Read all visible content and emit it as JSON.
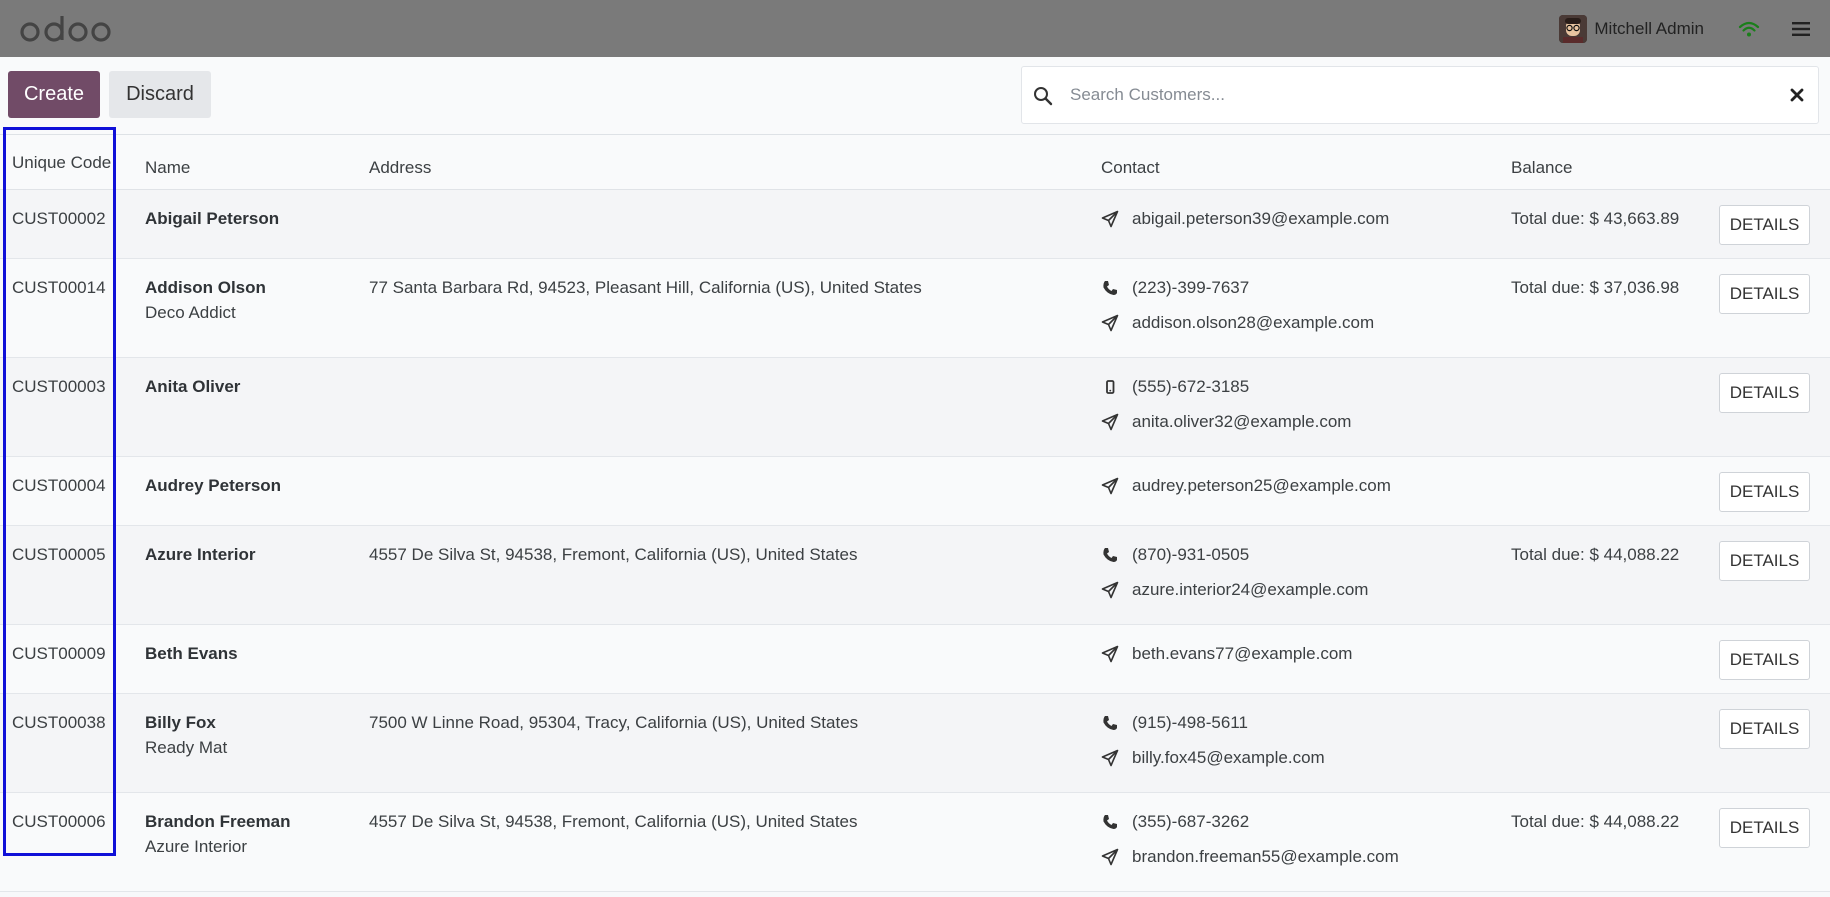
{
  "navbar": {
    "user_name": "Mitchell Admin"
  },
  "controls": {
    "create_label": "Create",
    "discard_label": "Discard",
    "search_placeholder": "Search Customers..."
  },
  "table": {
    "headers": {
      "code": "Unique Code",
      "name": "Name",
      "address": "Address",
      "contact": "Contact",
      "balance": "Balance"
    },
    "details_label": "DETAILS",
    "rows": [
      {
        "code": "CUST00002",
        "name": "Abigail Peterson",
        "company": "",
        "address": "",
        "phone": "",
        "phone_type": "",
        "email": "abigail.peterson39@example.com",
        "balance": "Total due: $ 43,663.89"
      },
      {
        "code": "CUST00014",
        "name": "Addison Olson",
        "company": "Deco Addict",
        "address": "77 Santa Barbara Rd, 94523, Pleasant Hill, California (US), United States",
        "phone": "(223)-399-7637",
        "phone_type": "phone",
        "email": "addison.olson28@example.com",
        "balance": "Total due: $ 37,036.98"
      },
      {
        "code": "CUST00003",
        "name": "Anita Oliver",
        "company": "",
        "address": "",
        "phone": "(555)-672-3185",
        "phone_type": "mobile",
        "email": "anita.oliver32@example.com",
        "balance": ""
      },
      {
        "code": "CUST00004",
        "name": "Audrey Peterson",
        "company": "",
        "address": "",
        "phone": "",
        "phone_type": "",
        "email": "audrey.peterson25@example.com",
        "balance": ""
      },
      {
        "code": "CUST00005",
        "name": "Azure Interior",
        "company": "",
        "address": "4557 De Silva St, 94538, Fremont, California (US), United States",
        "phone": "(870)-931-0505",
        "phone_type": "phone",
        "email": "azure.interior24@example.com",
        "balance": "Total due: $ 44,088.22"
      },
      {
        "code": "CUST00009",
        "name": "Beth Evans",
        "company": "",
        "address": "",
        "phone": "",
        "phone_type": "",
        "email": "beth.evans77@example.com",
        "balance": ""
      },
      {
        "code": "CUST00038",
        "name": "Billy Fox",
        "company": "Ready Mat",
        "address": "7500 W Linne Road, 95304, Tracy, California (US), United States",
        "phone": "(915)-498-5611",
        "phone_type": "phone",
        "email": "billy.fox45@example.com",
        "balance": ""
      },
      {
        "code": "CUST00006",
        "name": "Brandon Freeman",
        "company": "Azure Interior",
        "address": "4557 De Silva St, 94538, Fremont, California (US), United States",
        "phone": "(355)-687-3262",
        "phone_type": "phone",
        "email": "brandon.freeman55@example.com",
        "balance": "Total due: $ 44,088.22"
      }
    ]
  },
  "colors": {
    "brand": "#714b67",
    "highlight": "#1010d8",
    "navbar": "#7a7a7a"
  }
}
